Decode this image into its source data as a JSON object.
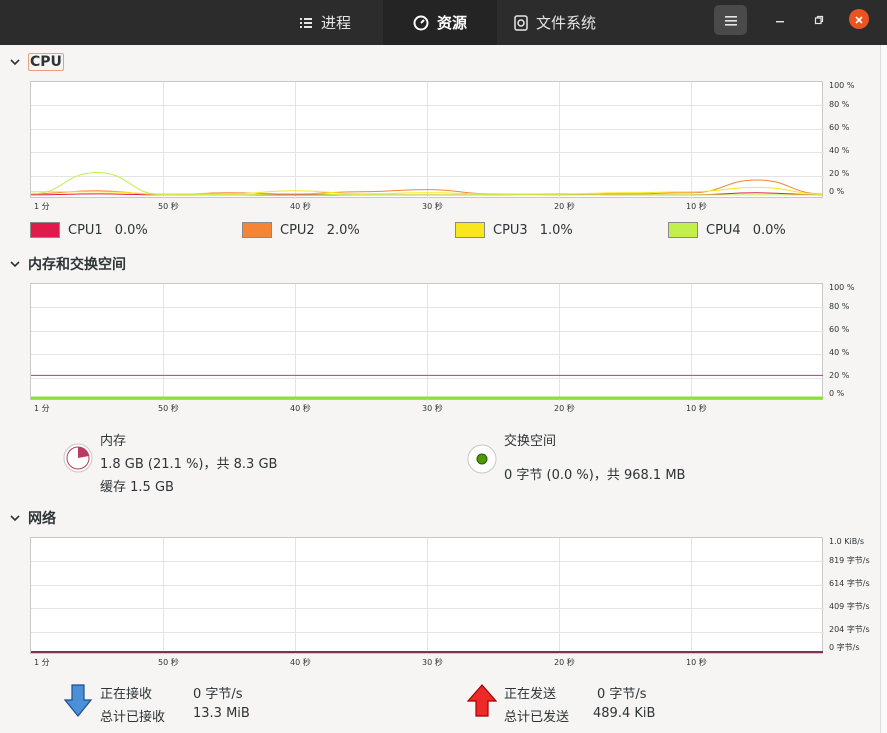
{
  "tabs": [
    {
      "label": "进程",
      "icon": "list-icon"
    },
    {
      "label": "资源",
      "icon": "gauge-icon"
    },
    {
      "label": "文件系统",
      "icon": "disk-icon"
    }
  ],
  "window": {
    "menu_icon": "hamburger-icon",
    "minimize_icon": "minimize-icon",
    "restore_icon": "restore-icon",
    "close_icon": "close-icon",
    "close_color": "#e95420"
  },
  "x_ticks": [
    "1 分",
    "50 秒",
    "40 秒",
    "30 秒",
    "20 秒",
    "10 秒"
  ],
  "cpu": {
    "title": "CPU",
    "y_ticks": [
      "100 %",
      "80 %",
      "60 %",
      "40 %",
      "20 %",
      "0 %"
    ],
    "legend": [
      {
        "name": "CPU1",
        "value": "0.0%",
        "color": "#e01b4c"
      },
      {
        "name": "CPU2",
        "value": "2.0%",
        "color": "#f58535"
      },
      {
        "name": "CPU3",
        "value": "1.0%",
        "color": "#f8e71c"
      },
      {
        "name": "CPU4",
        "value": "0.0%",
        "color": "#c2ef4b"
      }
    ]
  },
  "memory": {
    "title": "内存和交换空间",
    "y_ticks": [
      "100 %",
      "80 %",
      "60 %",
      "40 %",
      "20 %",
      "0 %"
    ],
    "ram_label": "内存",
    "ram_value": "1.8 GB (21.1 %)，共 8.3 GB",
    "cache_value": "缓存 1.5 GB",
    "ram_color": "#b83c64",
    "swap_label": "交换空间",
    "swap_value": "0 字节 (0.0 %)，共 968.1 MB",
    "swap_color": "#4e9a06"
  },
  "network": {
    "title": "网络",
    "y_ticks": [
      "1.0 KiB/s",
      "819 字节/s",
      "614 字节/s",
      "409 字节/s",
      "204 字节/s",
      "0 字节/s"
    ],
    "receiving_label": "正在接收",
    "receiving_value": "0 字节/s",
    "total_received_label": "总计已接收",
    "total_received_value": "13.3 MiB",
    "sending_label": "正在发送",
    "sending_value": "0 字节/s",
    "total_sent_label": "总计已发送",
    "total_sent_value": "489.4 KiB",
    "receive_color": "#3465a4",
    "send_color": "#cc0000"
  },
  "chart_data": [
    {
      "type": "line",
      "title": "CPU",
      "ylim": [
        0,
        100
      ],
      "x": [
        60,
        55,
        50,
        45,
        40,
        35,
        30,
        25,
        20,
        15,
        10,
        5,
        0
      ],
      "series": [
        {
          "name": "CPU1",
          "values": [
            1,
            2,
            1,
            1,
            1,
            1,
            1,
            1,
            2,
            1,
            1,
            3,
            1
          ]
        },
        {
          "name": "CPU2",
          "values": [
            2,
            5,
            1,
            3,
            2,
            4,
            6,
            2,
            1,
            2,
            3,
            15,
            2
          ]
        },
        {
          "name": "CPU3",
          "values": [
            4,
            4,
            2,
            2,
            5,
            2,
            3,
            2,
            2,
            3,
            4,
            8,
            2
          ]
        },
        {
          "name": "CPU4",
          "values": [
            2,
            22,
            1,
            1,
            2,
            1,
            1,
            1,
            1,
            1,
            1,
            1,
            1
          ]
        }
      ]
    },
    {
      "type": "line",
      "title": "内存和交换空间",
      "ylim": [
        0,
        100
      ],
      "x": [
        60,
        0
      ],
      "series": [
        {
          "name": "内存",
          "values": [
            21.1,
            21.1
          ]
        },
        {
          "name": "交换空间",
          "values": [
            0,
            0
          ]
        }
      ]
    },
    {
      "type": "line",
      "title": "网络",
      "x": [
        60,
        0
      ],
      "series": [
        {
          "name": "正在接收",
          "values": [
            0,
            0
          ]
        },
        {
          "name": "正在发送",
          "values": [
            0,
            0
          ]
        }
      ]
    }
  ]
}
